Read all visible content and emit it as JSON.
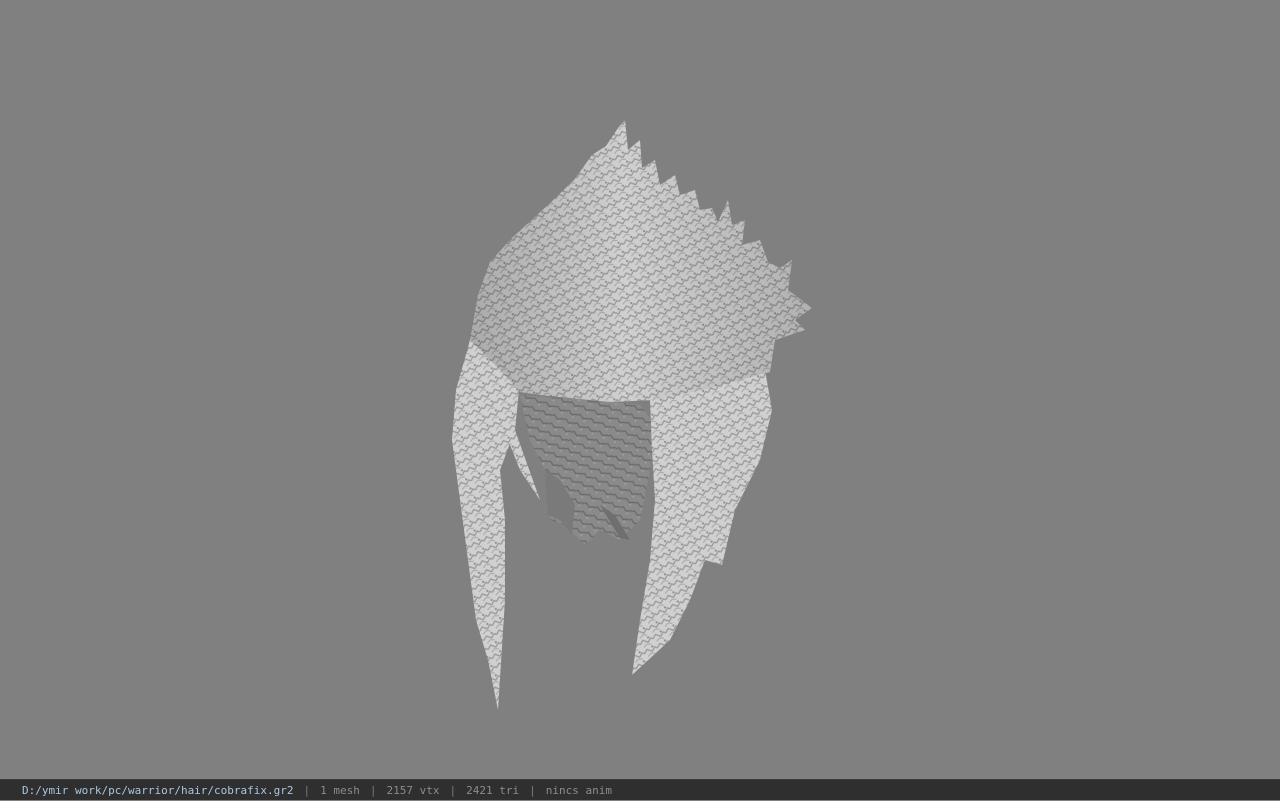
{
  "viewport": {
    "model_name": "cobrafix hair mesh",
    "background_color": "#808080",
    "model_color": "#c9c9c9"
  },
  "statusbar": {
    "file_path": "D:/ymir work/pc/warrior/hair/cobrafix.gr2",
    "separator": "|",
    "mesh_count": "1 mesh",
    "vertex_count": "2157 vtx",
    "triangle_count": "2421 tri",
    "anim_status": "nincs anim"
  }
}
